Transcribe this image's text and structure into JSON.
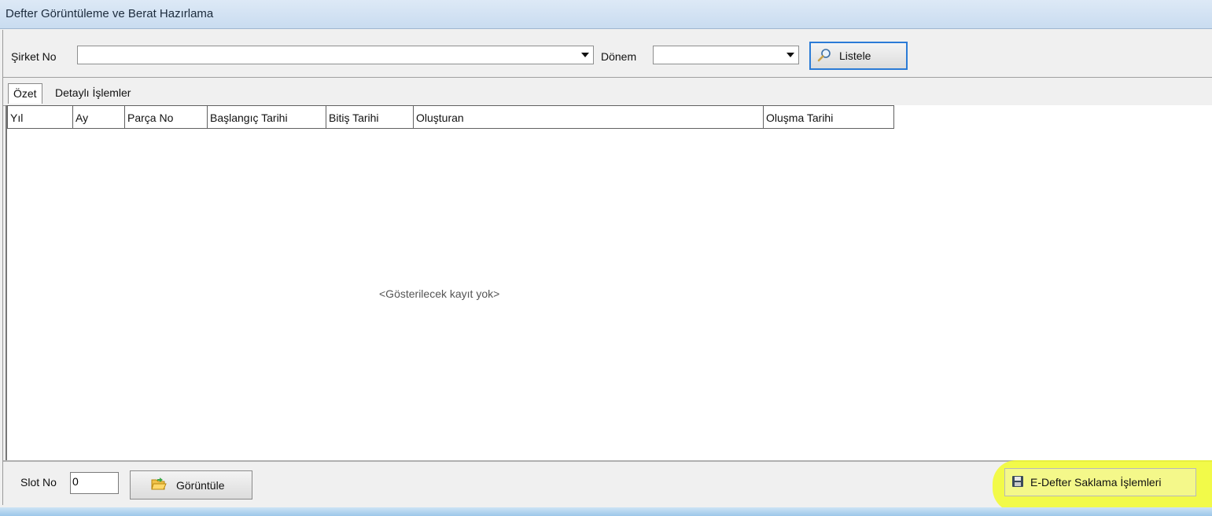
{
  "window": {
    "title": "Defter Görüntüleme ve Berat Hazırlama"
  },
  "filter": {
    "company_label": "Şirket No",
    "company_value": "",
    "period_label": "Dönem",
    "period_value": "",
    "list_button": "Listele"
  },
  "tabs": [
    {
      "label": "Özet",
      "active": true
    },
    {
      "label": "Detaylı İşlemler",
      "active": false
    }
  ],
  "table": {
    "columns": [
      "Yıl",
      "Ay",
      "Parça No",
      "Başlangıç Tarihi",
      "Bitiş Tarihi",
      "Oluşturan",
      "Oluşma Tarihi"
    ],
    "rows": [],
    "empty_text": "<Gösterilecek kayıt yok>"
  },
  "bottom": {
    "slot_label": "Slot No",
    "slot_value": "0",
    "view_button": "Görüntüle",
    "storage_button": "E-Defter Saklama İşlemleri"
  },
  "icons": {
    "list_button": "magnifier-icon",
    "view_button": "folder-open-icon",
    "storage_button": "floppy-disk-icon"
  },
  "colors": {
    "highlight": "#f2fb2c",
    "focus_border": "#2b7bd6"
  }
}
